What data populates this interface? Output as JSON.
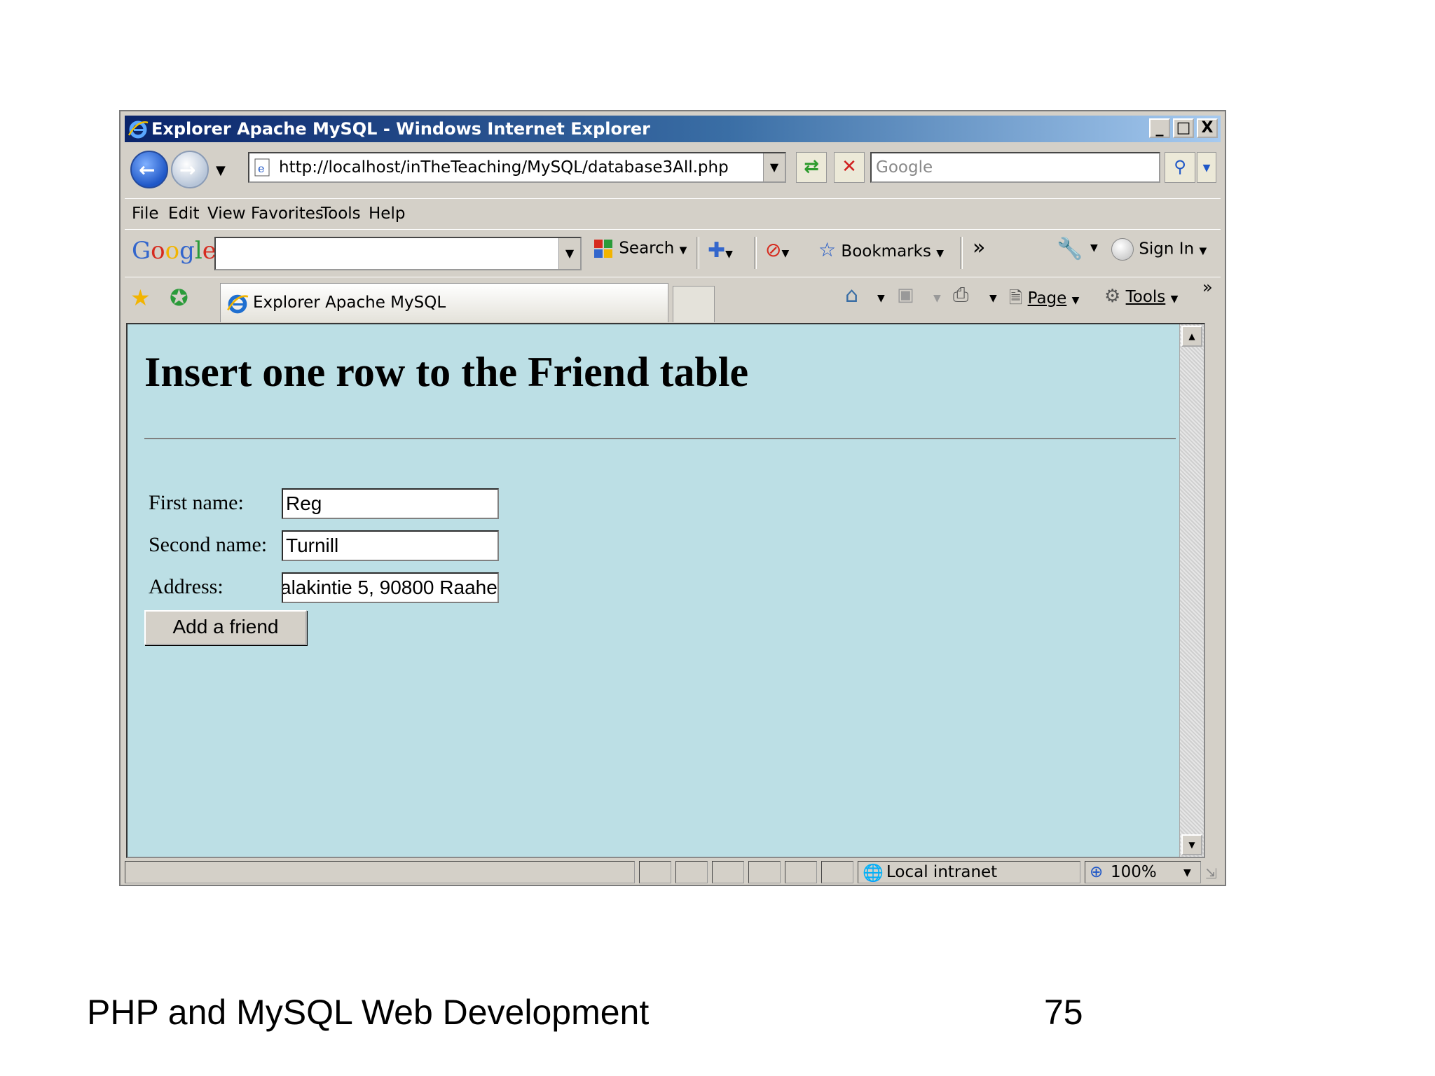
{
  "window": {
    "title": "Explorer Apache MySQL - Windows Internet Explorer",
    "minimize_glyph": "_",
    "maximize_glyph": "□",
    "close_glyph": "X"
  },
  "nav": {
    "address": "http://localhost/inTheTeaching/MySQL/database3All.php",
    "search_placeholder": "Google"
  },
  "menu": {
    "items": [
      "File",
      "Edit",
      "View",
      "Favorites",
      "Tools",
      "Help"
    ]
  },
  "google_toolbar": {
    "search_label": "Search",
    "bookmarks_label": "Bookmarks",
    "signin_label": "Sign In",
    "more_glyph": "»"
  },
  "tabs": {
    "active_label": "Explorer Apache MySQL",
    "page_label": "Page",
    "tools_label": "Tools",
    "more_glyph": "»"
  },
  "page": {
    "heading": "Insert one row to the Friend table",
    "fields": [
      {
        "label": "First name:",
        "value": "Reg"
      },
      {
        "label": "Second name:",
        "value": "Turnill"
      },
      {
        "label": "Address:",
        "value": "alakintie 5, 90800 Raahe"
      }
    ],
    "submit_label": "Add a friend"
  },
  "status": {
    "zone": "Local intranet",
    "zoom": "100%"
  },
  "footer": {
    "left_text": "PHP and MySQL Web Development",
    "page_number": "75"
  },
  "colors": {
    "content_background": "#bcdfe5",
    "title_gradient_start": "#0a246a",
    "title_gradient_end": "#a6caf0",
    "chrome": "#d4d0c8"
  }
}
